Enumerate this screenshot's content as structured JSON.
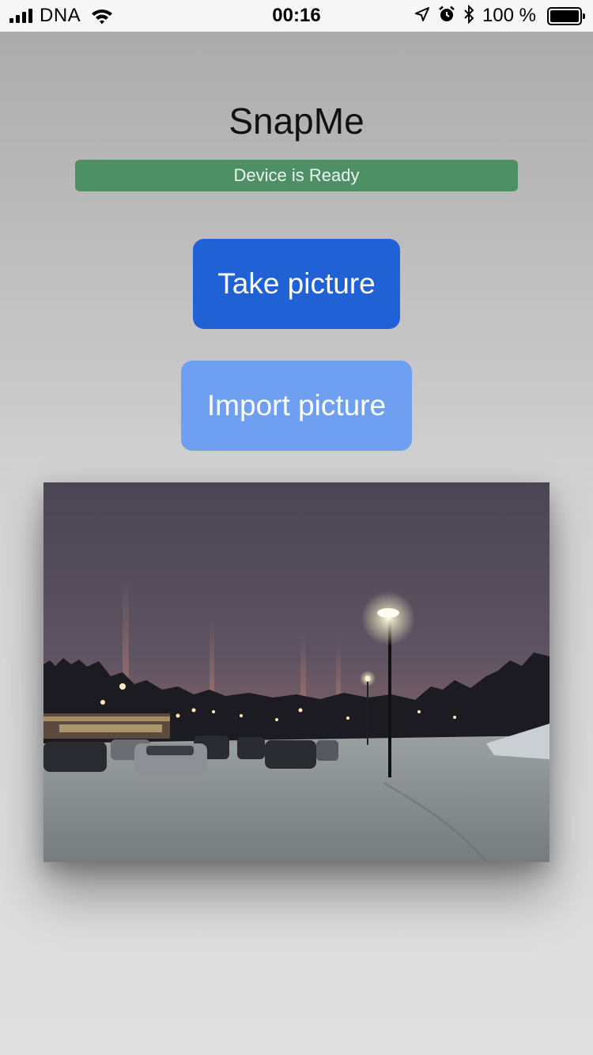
{
  "status_bar": {
    "carrier": "DNA",
    "time": "00:16",
    "battery": "100 %",
    "battery_level": 1.0,
    "icons": [
      "signal-bars-icon",
      "wifi-icon",
      "location-arrow-icon",
      "alarm-icon",
      "bluetooth-icon",
      "battery-icon"
    ]
  },
  "app": {
    "title": "SnapMe",
    "status_message": "Device is Ready",
    "take_picture_label": "Take picture",
    "import_picture_label": "Import picture"
  },
  "colors": {
    "status_ready": "#4e9066",
    "take_button": "#2062d6",
    "import_button": "#6f9ff1"
  }
}
